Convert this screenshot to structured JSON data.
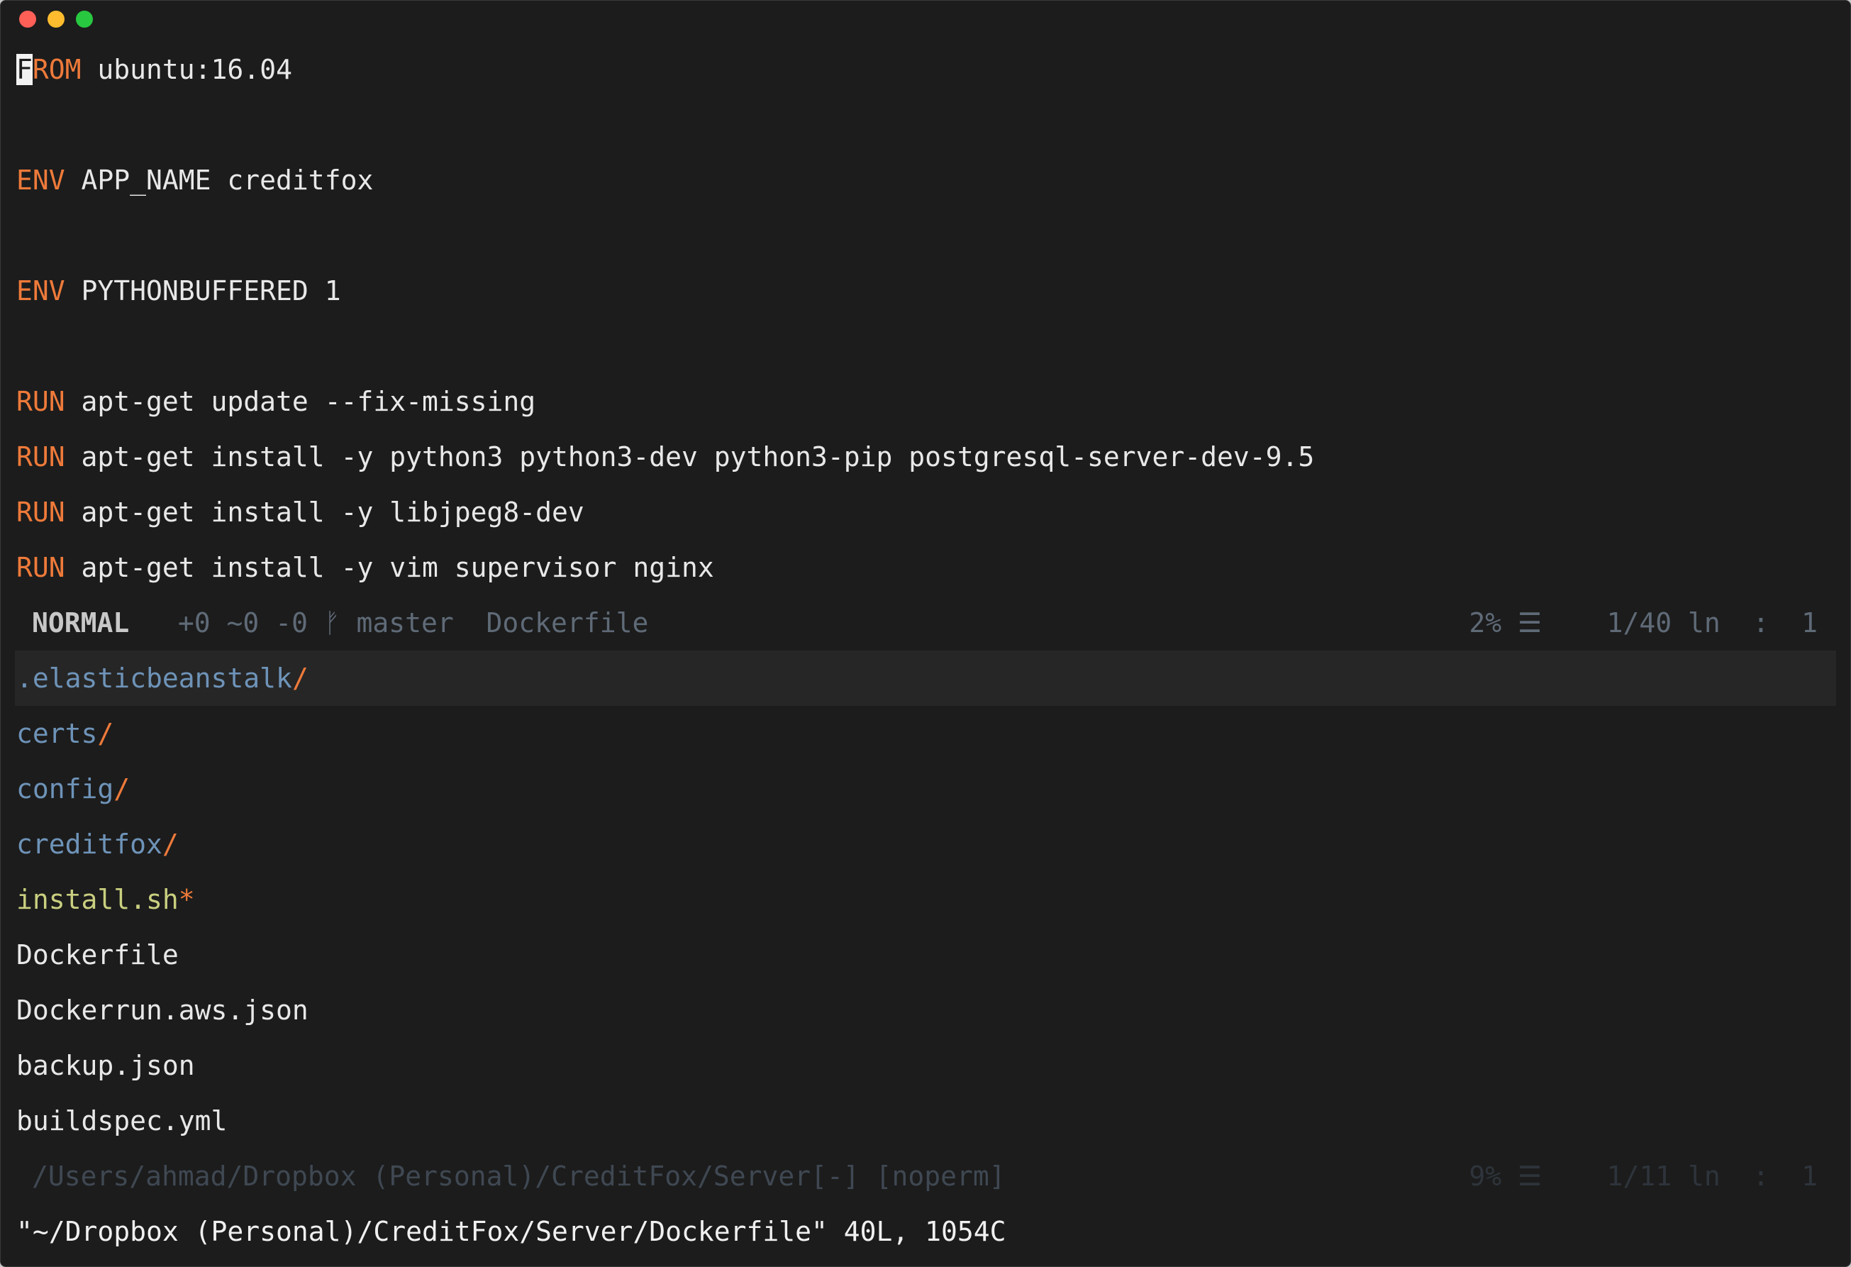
{
  "editor": {
    "lines": [
      {
        "kw_cursor": "F",
        "kw": "ROM",
        "text": " ubuntu:16.04"
      },
      {
        "kw": "ENV",
        "text": " APP_NAME creditfox"
      },
      {
        "kw": "ENV",
        "text": " PYTHONBUFFERED 1"
      },
      {
        "kw": "RUN",
        "text": " apt-get update --fix-missing"
      },
      {
        "kw": "RUN",
        "text": " apt-get install -y python3 python3-dev python3-pip postgresql-server-dev-9.5"
      },
      {
        "kw": "RUN",
        "text": " apt-get install -y libjpeg8-dev"
      },
      {
        "kw": "RUN",
        "text": " apt-get install -y vim supervisor nginx"
      }
    ]
  },
  "statusline": {
    "mode": "NORMAL",
    "git": "+0 ~0 -0 ᚠ master",
    "filename": "Dockerfile",
    "right": "2% ☰    1/40 ln  :  1"
  },
  "filetree": {
    "items": [
      {
        "name": ".elasticbeanstalk",
        "suffix": "/",
        "kind": "dir"
      },
      {
        "name": "certs",
        "suffix": "/",
        "kind": "dir"
      },
      {
        "name": "config",
        "suffix": "/",
        "kind": "dir"
      },
      {
        "name": "creditfox",
        "suffix": "/",
        "kind": "dir"
      },
      {
        "name": "install.sh",
        "suffix": "*",
        "kind": "exe"
      },
      {
        "name": "Dockerfile",
        "suffix": "",
        "kind": "file"
      },
      {
        "name": "Dockerrun.aws.json",
        "suffix": "",
        "kind": "file"
      },
      {
        "name": "backup.json",
        "suffix": "",
        "kind": "file"
      },
      {
        "name": "buildspec.yml",
        "suffix": "",
        "kind": "file"
      }
    ]
  },
  "tree_statusline": {
    "path": "/Users/ahmad/Dropbox (Personal)/CreditFox/Server[-] [noperm]",
    "right": "9% ☰    1/11 ln  :  1"
  },
  "message": "\"~/Dropbox (Personal)/CreditFox/Server/Dockerfile\" 40L, 1054C",
  "colors": {
    "background": "#1c1c1c",
    "keyword": "#ee7a3a",
    "directory": "#6e93b8",
    "executable": "#c9cf7f"
  }
}
